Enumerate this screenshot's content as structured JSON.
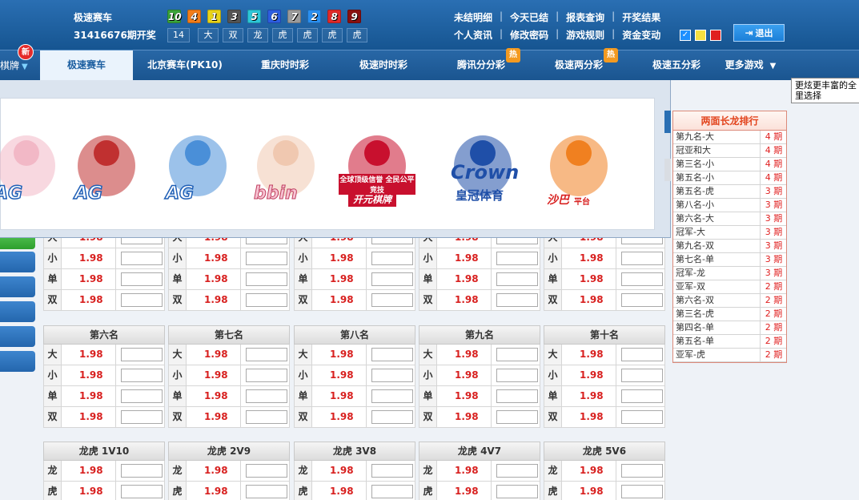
{
  "header": {
    "game_name": "极速赛车",
    "period_text": "31416676期开奖",
    "balls": [
      {
        "num": "10",
        "color": "#3aa53a"
      },
      {
        "num": "4",
        "color": "#f27d1a"
      },
      {
        "num": "1",
        "color": "#e8d31a"
      },
      {
        "num": "3",
        "color": "#555555"
      },
      {
        "num": "5",
        "color": "#2cc7d8"
      },
      {
        "num": "6",
        "color": "#2d5de0"
      },
      {
        "num": "7",
        "color": "#9b9b9b"
      },
      {
        "num": "2",
        "color": "#2a8ff0"
      },
      {
        "num": "8",
        "color": "#e02a2a"
      },
      {
        "num": "9",
        "color": "#8a1010"
      }
    ],
    "stats": [
      "14",
      "大",
      "双",
      "龙",
      "虎",
      "虎",
      "虎",
      "虎"
    ],
    "links_row1": [
      "未结明细",
      "今天已结",
      "报表查询",
      "开奖结果"
    ],
    "links_row2": [
      "个人资讯",
      "修改密码",
      "游戏规则",
      "资金变动"
    ],
    "theme_colors": [
      "#1e90ff",
      "#f5e040",
      "#e02020"
    ],
    "logout_label": "退出",
    "logout_icon": "exit-icon"
  },
  "nav": {
    "chess_label": "棋牌",
    "new_badge": "新",
    "tabs": [
      {
        "label": "极速赛车",
        "active": true
      },
      {
        "label": "北京赛车(PK10)"
      },
      {
        "label": "重庆时时彩"
      },
      {
        "label": "极速时时彩"
      },
      {
        "label": "腾讯分分彩",
        "hot": "热"
      },
      {
        "label": "极速两分彩",
        "hot": "热"
      },
      {
        "label": "极速五分彩"
      },
      {
        "label": "更多游戏"
      }
    ]
  },
  "tooltip": "更炫更丰富的全里选择",
  "promo": {
    "brands": [
      {
        "name": "AG"
      },
      {
        "name": "AG"
      },
      {
        "name": "AG"
      },
      {
        "name": "bbin"
      },
      {
        "name": "开元棋牌",
        "slogan": "全球顶级信誉 全民公平竞技"
      },
      {
        "name": "Crown",
        "sub": "皇冠体育"
      },
      {
        "name": "沙巴",
        "sub": "平台"
      }
    ]
  },
  "betting": {
    "big_small_labels": [
      "大",
      "小",
      "单",
      "双"
    ],
    "odds": "1.98",
    "group2_titles": [
      "第六名",
      "第七名",
      "第八名",
      "第九名",
      "第十名"
    ],
    "dragon_titles": [
      "龙虎 1V10",
      "龙虎 2V9",
      "龙虎 3V8",
      "龙虎 4V7",
      "龙虎 5V6"
    ],
    "dragon_labels": [
      "龙",
      "虎"
    ]
  },
  "ranking": {
    "title": "两面长龙排行",
    "rows": [
      {
        "name": "第九名-大",
        "value": "4 期"
      },
      {
        "name": "冠亚和大",
        "value": "4 期"
      },
      {
        "name": "第三名-小",
        "value": "4 期"
      },
      {
        "name": "第五名-小",
        "value": "4 期"
      },
      {
        "name": "第五名-虎",
        "value": "3 期"
      },
      {
        "name": "第八名-小",
        "value": "3 期"
      },
      {
        "name": "第六名-大",
        "value": "3 期"
      },
      {
        "name": "冠军-大",
        "value": "3 期"
      },
      {
        "name": "第九名-双",
        "value": "3 期"
      },
      {
        "name": "第七名-单",
        "value": "3 期"
      },
      {
        "name": "冠军-龙",
        "value": "3 期"
      },
      {
        "name": "亚军-双",
        "value": "2 期"
      },
      {
        "name": "第六名-双",
        "value": "2 期"
      },
      {
        "name": "第三名-虎",
        "value": "2 期"
      },
      {
        "name": "第四名-单",
        "value": "2 期"
      },
      {
        "name": "第五名-单",
        "value": "2 期"
      },
      {
        "name": "亚军-虎",
        "value": "2 期"
      }
    ]
  }
}
